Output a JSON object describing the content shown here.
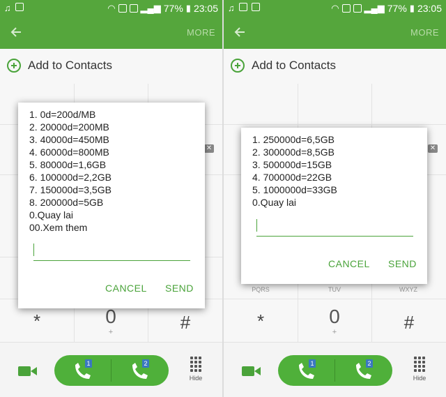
{
  "status": {
    "battery": "77%",
    "time": "23:05"
  },
  "appbar": {
    "more_label": "MORE"
  },
  "add_contacts_label": "Add to Contacts",
  "left_dialog": {
    "lines": [
      "1. 0d=200d/MB",
      "2. 20000d=200MB",
      "3. 40000d=450MB",
      "4. 60000d=800MB",
      "5. 80000d=1,6GB",
      "6. 100000d=2,2GB",
      "7. 150000d=3,5GB",
      "8. 200000d=5GB",
      "0.Quay lai",
      "00.Xem them"
    ],
    "cancel_label": "CANCEL",
    "send_label": "SEND"
  },
  "right_dialog": {
    "lines": [
      "1. 250000d=6,5GB",
      "2. 300000d=8,5GB",
      "3. 500000d=15GB",
      "4. 700000d=22GB",
      "5. 1000000d=33GB",
      "0.Quay lai"
    ],
    "cancel_label": "CANCEL",
    "send_label": "SEND"
  },
  "keypad": {
    "row3_letters": [
      "PQRS",
      "TUV",
      "WXYZ"
    ],
    "star": "*",
    "zero": "0",
    "plus": "+",
    "hash": "#"
  },
  "bottom": {
    "sim1": "1",
    "sim2": "2",
    "hide_label": "Hide"
  },
  "colors": {
    "accent": "#55a63c",
    "button_green": "#4fb03a",
    "sim_badge": "#3a78c0"
  }
}
